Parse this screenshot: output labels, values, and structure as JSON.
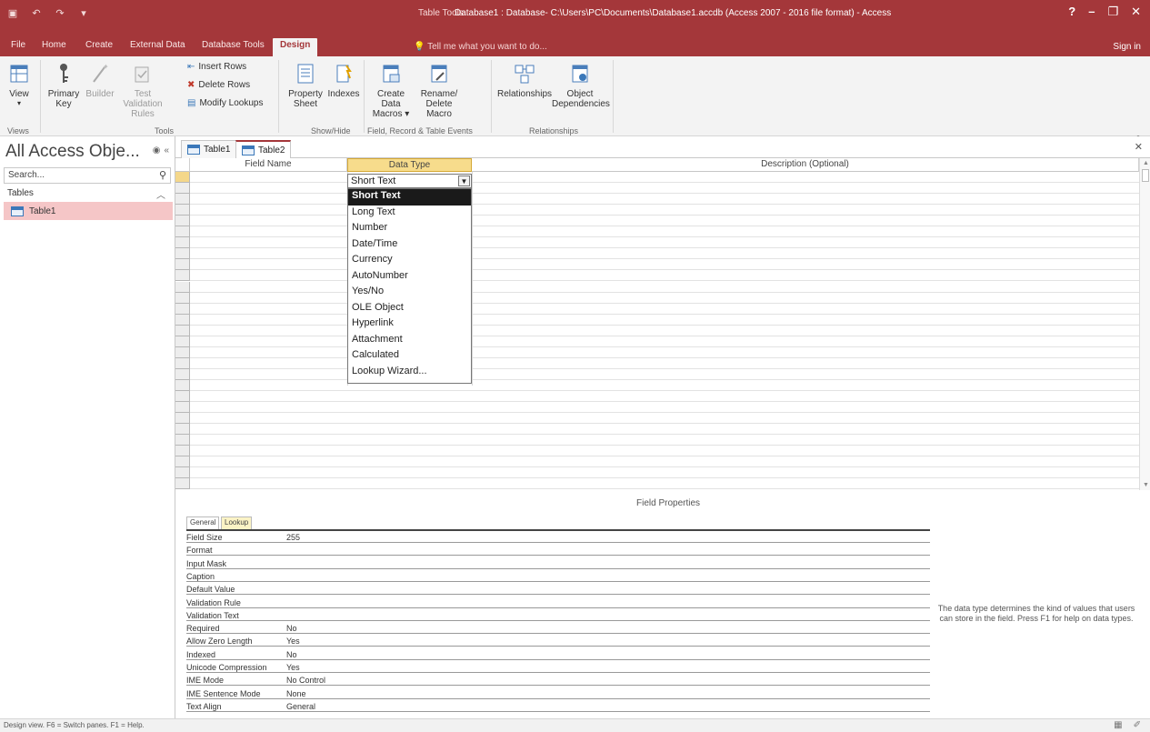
{
  "titlebar": {
    "context_label": "Table Tools",
    "title": "Database1 : Database- C:\\Users\\PC\\Documents\\Database1.accdb (Access 2007 - 2016 file format) - Access",
    "controls": {
      "help": "?",
      "minimize": "–",
      "restore": "❐",
      "close": "✕"
    }
  },
  "tabs": {
    "file": "File",
    "home": "Home",
    "create": "Create",
    "external": "External Data",
    "dbtools": "Database Tools",
    "design": "Design",
    "tellme": "Tell me what you want to do...",
    "signin": "Sign in"
  },
  "ribbon": {
    "view": "View",
    "primary_key": "Primary Key",
    "builder": "Builder",
    "test_rules": "Test Validation Rules",
    "insert_rows": "Insert Rows",
    "delete_rows": "Delete Rows",
    "modify_lookups": "Modify Lookups",
    "property_sheet": "Property Sheet",
    "indexes": "Indexes",
    "create_data_macros": "Create Data Macros ▾",
    "rename_delete_macro": "Rename/ Delete Macro",
    "relationships": "Relationships",
    "object_dependencies": "Object Dependencies",
    "groups": {
      "views": "Views",
      "tools": "Tools",
      "showhide": "Show/Hide",
      "field_events": "Field, Record & Table Events",
      "relationships": "Relationships"
    }
  },
  "nav": {
    "title": "All Access Obje...",
    "search_placeholder": "Search...",
    "group": "Tables",
    "items": [
      "Table1"
    ]
  },
  "doctabs": [
    "Table1",
    "Table2"
  ],
  "grid": {
    "headers": {
      "field_name": "Field Name",
      "data_type": "Data Type",
      "description": "Description (Optional)"
    },
    "current_type": "Short Text"
  },
  "dropdown": {
    "options": [
      "Short Text",
      "Long Text",
      "Number",
      "Date/Time",
      "Currency",
      "AutoNumber",
      "Yes/No",
      "OLE Object",
      "Hyperlink",
      "Attachment",
      "Calculated",
      "Lookup Wizard..."
    ],
    "selected": "Short Text"
  },
  "field_properties": {
    "title": "Field Properties",
    "tabs": [
      "General",
      "Lookup"
    ],
    "rows": [
      {
        "label": "Field Size",
        "value": "255"
      },
      {
        "label": "Format",
        "value": ""
      },
      {
        "label": "Input Mask",
        "value": ""
      },
      {
        "label": "Caption",
        "value": ""
      },
      {
        "label": "Default Value",
        "value": ""
      },
      {
        "label": "Validation Rule",
        "value": ""
      },
      {
        "label": "Validation Text",
        "value": ""
      },
      {
        "label": "Required",
        "value": "No"
      },
      {
        "label": "Allow Zero Length",
        "value": "Yes"
      },
      {
        "label": "Indexed",
        "value": "No"
      },
      {
        "label": "Unicode Compression",
        "value": "Yes"
      },
      {
        "label": "IME Mode",
        "value": "No Control"
      },
      {
        "label": "IME Sentence Mode",
        "value": "None"
      },
      {
        "label": "Text Align",
        "value": "General"
      }
    ],
    "help": "The data type determines the kind of values that users can store in the field. Press F1 for help on data types."
  },
  "statusbar": {
    "left": "Design view.  F6 = Switch panes.  F1 = Help.",
    "icons": [
      "datasheet-view",
      "design-view"
    ]
  },
  "colors": {
    "accent": "#a4373a",
    "selected_header": "#f7dc8c",
    "nav_selected": "#f5c6c7"
  }
}
